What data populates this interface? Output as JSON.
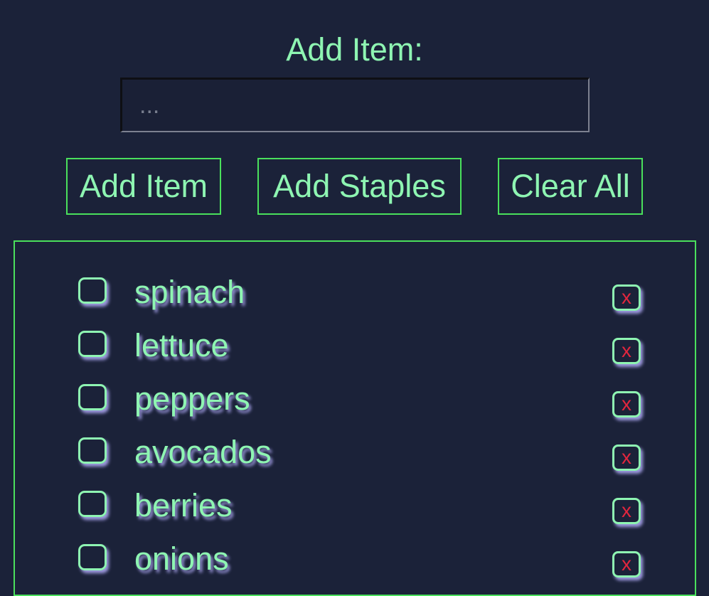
{
  "form": {
    "label": "Add Item:",
    "input_value": "",
    "input_placeholder": "..."
  },
  "buttons": {
    "add_item": "Add Item",
    "add_staples": "Add Staples",
    "clear_all": "Clear All"
  },
  "list": {
    "items": [
      {
        "label": "spinach",
        "checked": false,
        "delete_label": "x"
      },
      {
        "label": "lettuce",
        "checked": false,
        "delete_label": "x"
      },
      {
        "label": "peppers",
        "checked": false,
        "delete_label": "x"
      },
      {
        "label": "avocados",
        "checked": false,
        "delete_label": "x"
      },
      {
        "label": "berries",
        "checked": false,
        "delete_label": "x"
      },
      {
        "label": "onions",
        "checked": false,
        "delete_label": "x"
      }
    ]
  },
  "colors": {
    "background": "#1b2239",
    "text": "#8ef5b2",
    "border_accent": "#4ae05c",
    "delete_x": "#e2263e",
    "shadow": "#b6b0ff"
  },
  "icons": {
    "checkbox": "checkbox-unchecked-icon",
    "delete": "delete-x-icon"
  }
}
